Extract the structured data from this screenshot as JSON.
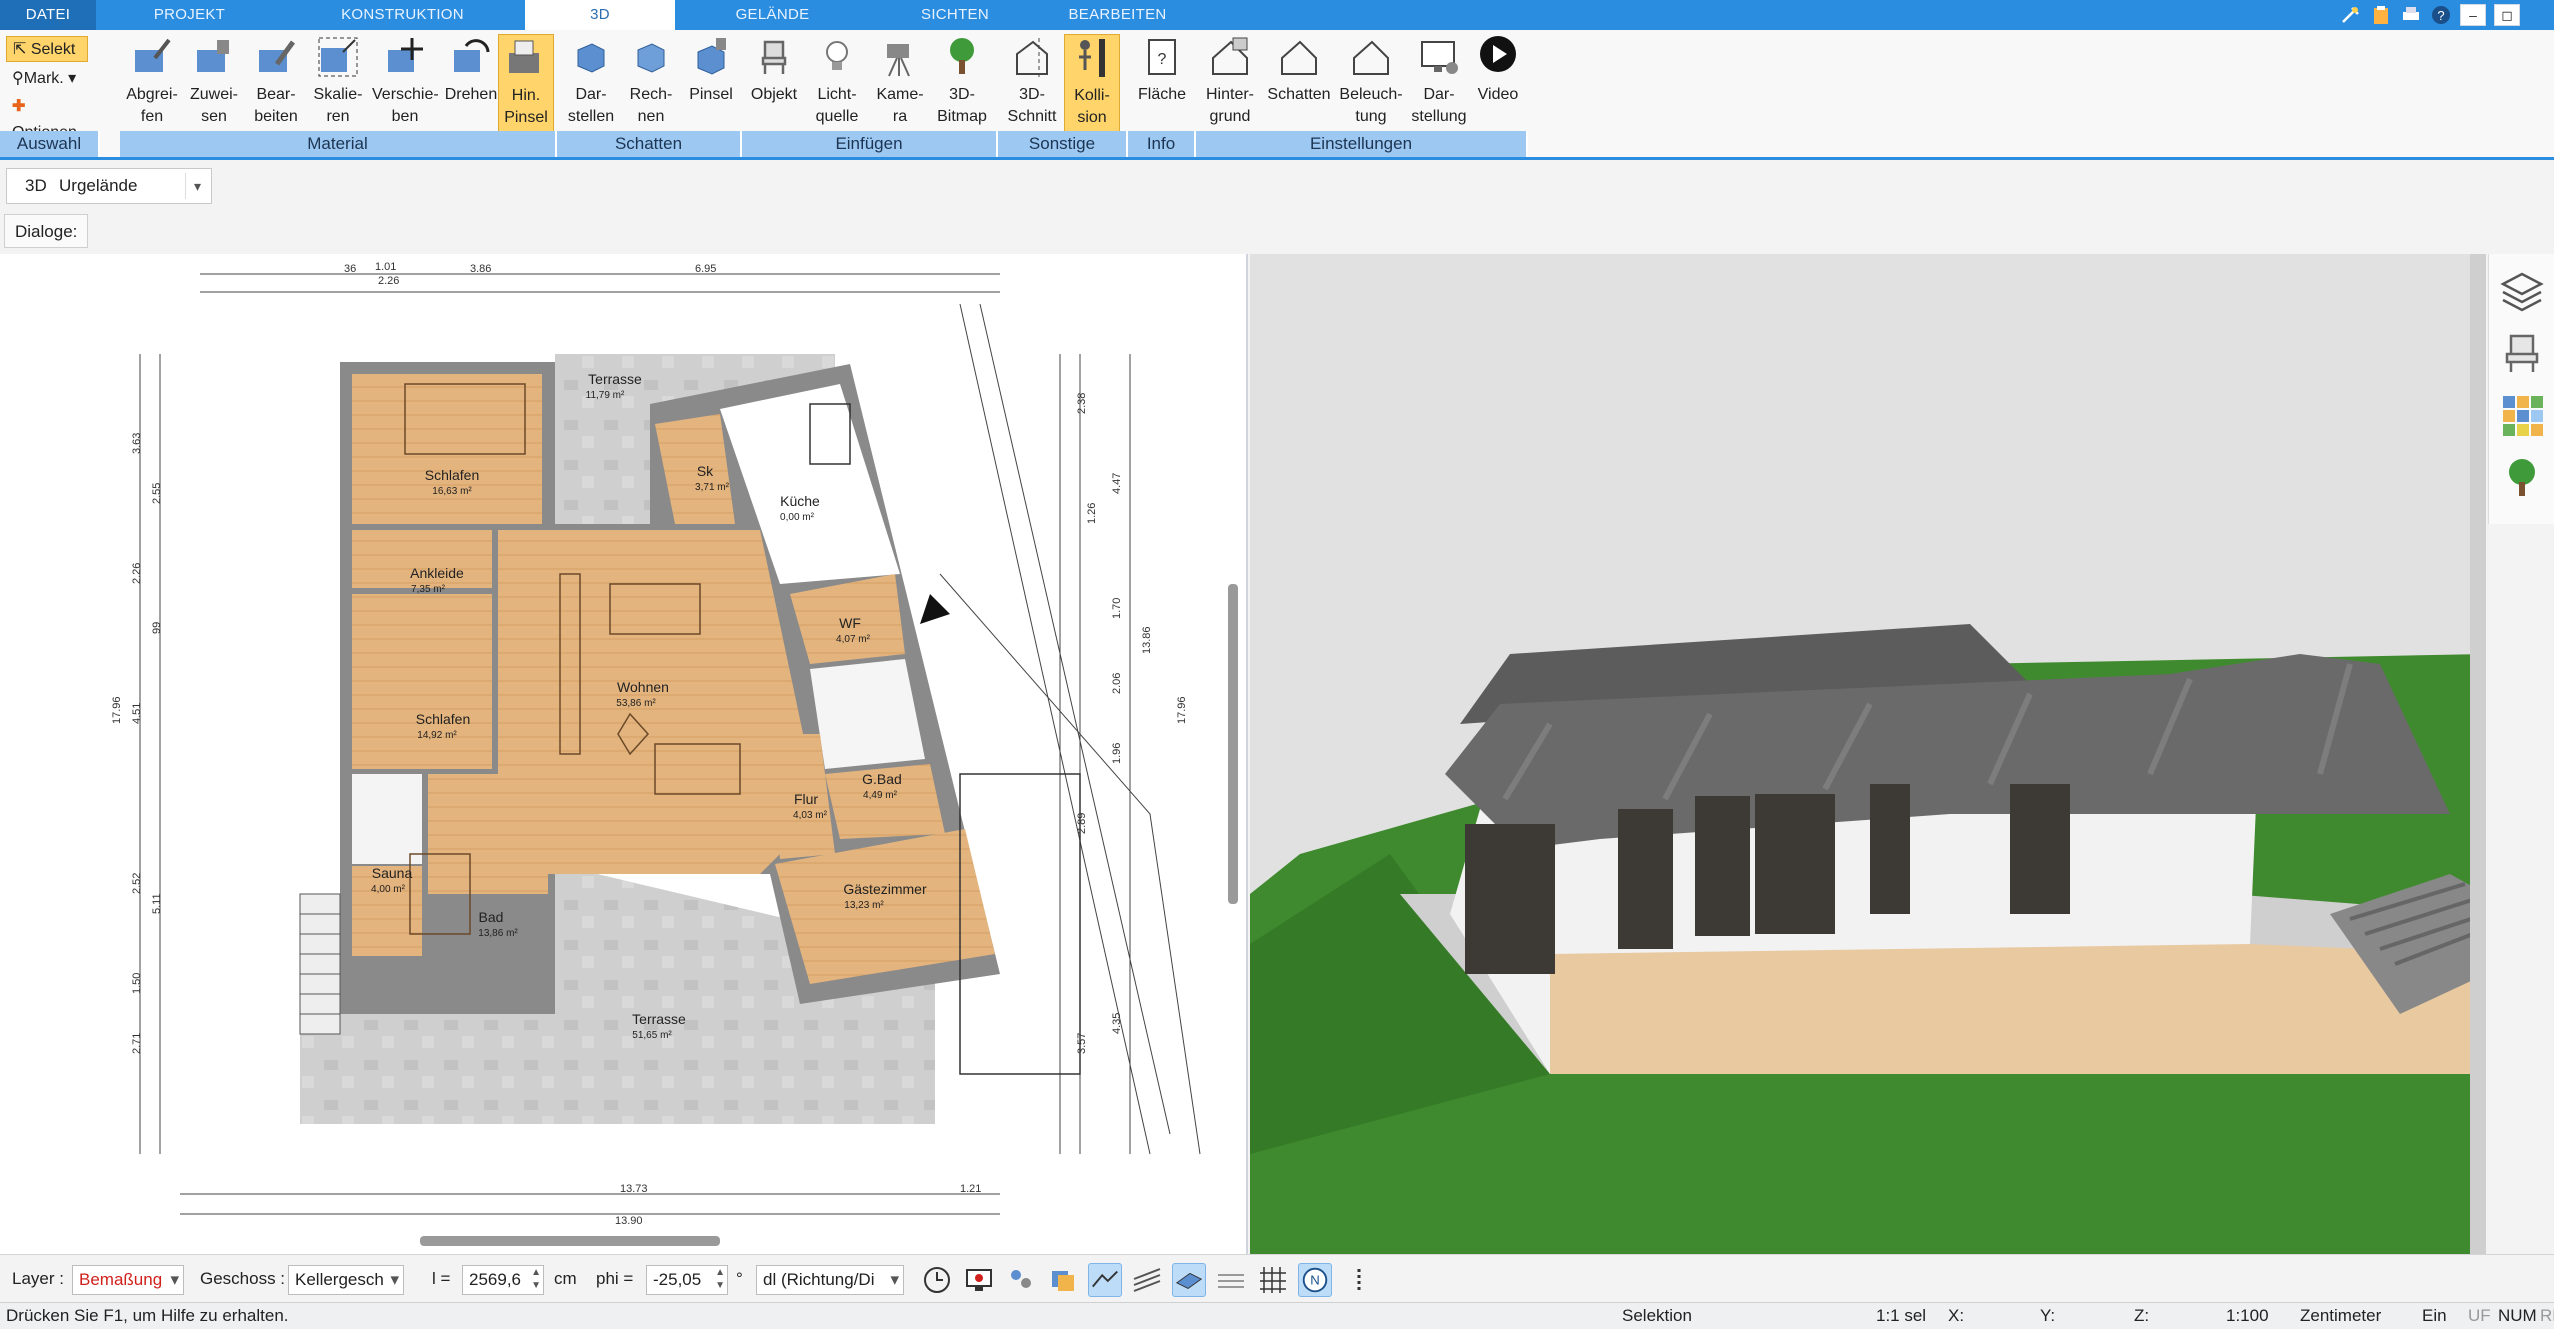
{
  "tabs": [
    "DATEI",
    "PROJEKT",
    "KONSTRUKTION",
    "3D",
    "GELÄNDE",
    "SICHTEN",
    "BEARBEITEN"
  ],
  "ribbon": {
    "auswahl": {
      "label": "Auswahl",
      "selekt": "Selekt",
      "mark": "Mark.",
      "optionen": "Optionen"
    },
    "material": {
      "label": "Material",
      "buttons": [
        "Abgrei-\nfen",
        "Zuwei-\nsen",
        "Bear-\nbeiten",
        "Skalie-\nren",
        "Verschie-\nben",
        "Drehen",
        "Hin.\nPinsel"
      ]
    },
    "schatten": {
      "label": "Schatten",
      "buttons": [
        "Dar-\nstellen",
        "Rech-\nnen",
        "Pinsel"
      ]
    },
    "einfuegen": {
      "label": "Einfügen",
      "buttons": [
        "Objekt",
        "Licht-\nquelle",
        "Kame-\nra",
        "3D-\nBitmap"
      ]
    },
    "sonstige": {
      "label": "Sonstige",
      "buttons": [
        "3D-\nSchnitt",
        "Kolli-\nsion"
      ]
    },
    "info": {
      "label": "Info",
      "buttons": [
        "Fläche"
      ]
    },
    "einstellungen": {
      "label": "Einstellungen",
      "buttons": [
        "Hinter-\ngrund",
        "Schatten",
        "Beleuch-\ntung",
        "Dar-\nstellung",
        "Video"
      ]
    }
  },
  "bar2": {
    "mode": "3D",
    "terrain_select": "Urgelände"
  },
  "bar3": {
    "dialoge": "Dialoge:"
  },
  "plan": {
    "rooms": [
      {
        "name": "Terrasse",
        "area": "11,79 m²"
      },
      {
        "name": "Schlafen",
        "area": "16,63 m²"
      },
      {
        "name": "Sk",
        "area": "3,71 m²"
      },
      {
        "name": "Küche",
        "area": "0,00 m²"
      },
      {
        "name": "Ankleide",
        "area": "7,35 m²"
      },
      {
        "name": "WF",
        "area": "4,07 m²"
      },
      {
        "name": "Wohnen",
        "area": "53,86 m²"
      },
      {
        "name": "Schlafen",
        "area": "14,92 m²"
      },
      {
        "name": "G.Bad",
        "area": "4,49 m²"
      },
      {
        "name": "Flur",
        "area": "4,03 m²"
      },
      {
        "name": "Gästezimmer",
        "area": "13,23 m²"
      },
      {
        "name": "Sauna",
        "area": "4,00 m²"
      },
      {
        "name": "Bad",
        "area": "13,86 m²"
      },
      {
        "name": "Terrasse",
        "area": "51,65 m²"
      }
    ],
    "dims_top": [
      "36",
      "1.01",
      "2.26",
      "3.86",
      "6.95"
    ],
    "dims_left": [
      "3.63",
      "2.55",
      "2.26",
      "99",
      "4.51",
      "17.96",
      "2.52",
      "5.11",
      "1.50",
      "2.71"
    ],
    "dims_right": [
      "2.38",
      "4.47",
      "1.26",
      "1.70",
      "13.86",
      "2.06",
      "1.96",
      "2.89",
      "3.57",
      "4.35",
      "17.96"
    ],
    "dims_bottom": [
      "13.73",
      "13.90",
      "1.21"
    ]
  },
  "bottombar": {
    "layer_label": "Layer :",
    "layer_value": "Bemaßung",
    "geschoss_label": "Geschoss :",
    "geschoss_value": "Kellergesch",
    "l_label": "l =",
    "l_value": "2569,6",
    "l_unit": "cm",
    "phi_label": "phi =",
    "phi_value": "-25,05",
    "phi_unit": "°",
    "dl_value": "dl (Richtung/Di"
  },
  "status": {
    "help": "Drücken Sie F1, um Hilfe zu erhalten.",
    "mode": "Selektion",
    "scale_sel": "1:1 sel",
    "x": "X:",
    "y": "Y:",
    "z": "Z:",
    "scale": "1:100",
    "unit": "Zentimeter",
    "ein": "Ein",
    "uf": "UF",
    "num": "NUM",
    "rf": "RF"
  },
  "colors": {
    "accent": "#2b8de0",
    "group_label": "#9cc8f2",
    "selected": "#ffd56b",
    "floor_wood": "#e3b27b",
    "terrace": "#c9c9c9",
    "grass": "#3f8a2e",
    "roof": "#6d6d6d"
  }
}
